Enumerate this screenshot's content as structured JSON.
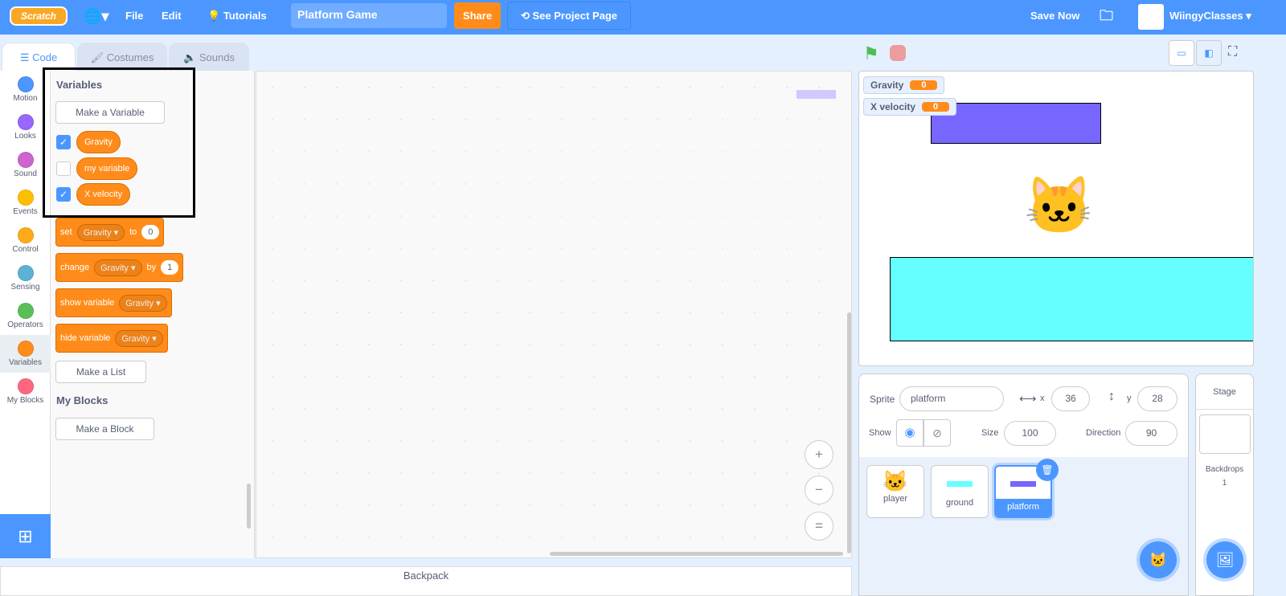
{
  "header": {
    "logo": "Scratch",
    "file": "File",
    "edit": "Edit",
    "tutorials": "Tutorials",
    "project_title": "Platform Game",
    "share": "Share",
    "see_project_page": "See Project Page",
    "save_now": "Save Now",
    "username": "WiingyClasses"
  },
  "tabs": [
    {
      "label": "Code"
    },
    {
      "label": "Costumes"
    },
    {
      "label": "Sounds"
    }
  ],
  "categories": [
    {
      "label": "Motion",
      "color": "#4c97ff"
    },
    {
      "label": "Looks",
      "color": "#9966ff"
    },
    {
      "label": "Sound",
      "color": "#cf63cf"
    },
    {
      "label": "Events",
      "color": "#ffbf00"
    },
    {
      "label": "Control",
      "color": "#ffab19"
    },
    {
      "label": "Sensing",
      "color": "#5cb1d6"
    },
    {
      "label": "Operators",
      "color": "#59c059"
    },
    {
      "label": "Variables",
      "color": "#ff8c1a"
    },
    {
      "label": "My Blocks",
      "color": "#ff6680"
    }
  ],
  "palette": {
    "variables_heading": "Variables",
    "make_variable": "Make a Variable",
    "variables": [
      {
        "name": "Gravity",
        "checked": true
      },
      {
        "name": "my variable",
        "checked": false
      },
      {
        "name": "X velocity",
        "checked": true
      }
    ],
    "blocks": {
      "set": "set",
      "set_var": "Gravity",
      "to": "to",
      "set_val": "0",
      "change": "change",
      "change_var": "Gravity",
      "by": "by",
      "change_val": "1",
      "show": "show variable",
      "show_var": "Gravity",
      "hide": "hide variable",
      "hide_var": "Gravity"
    },
    "make_list": "Make a List",
    "myblocks_heading": "My Blocks",
    "make_block": "Make a Block"
  },
  "zoom": {
    "in": "+",
    "out": "−",
    "reset": "="
  },
  "backpack": "Backpack",
  "stage": {
    "monitors": [
      {
        "label": "Gravity",
        "value": "0"
      },
      {
        "label": "X velocity",
        "value": "0"
      }
    ],
    "platform_color": "#7766ff",
    "ground_color": "#66ffff"
  },
  "sprite_info": {
    "sprite_label": "Sprite",
    "name": "platform",
    "x_label": "x",
    "x": "36",
    "y_label": "y",
    "y": "28",
    "show_label": "Show",
    "size_label": "Size",
    "size": "100",
    "direction_label": "Direction",
    "direction": "90"
  },
  "sprites": [
    {
      "name": "player"
    },
    {
      "name": "ground"
    },
    {
      "name": "platform",
      "selected": true
    }
  ],
  "stage_pane": {
    "title": "Stage",
    "backdrops_label": "Backdrops",
    "backdrops_count": "1"
  }
}
